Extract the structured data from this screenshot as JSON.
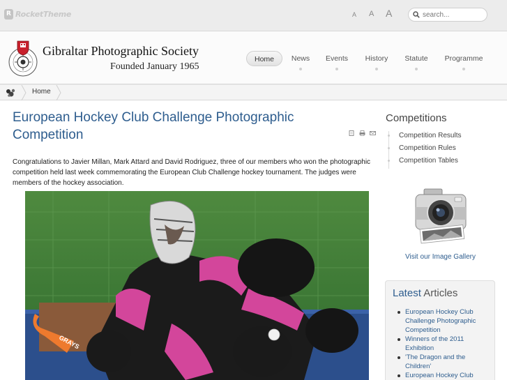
{
  "topbar": {
    "brand": "RocketTheme",
    "font_sizes": [
      "A",
      "A",
      "A"
    ],
    "search_placeholder": "search..."
  },
  "header": {
    "title": "Gibraltar Photographic Society",
    "subtitle": "Founded January 1965",
    "seal_text": "GIBRALTAR PHOTOGRAPHIC SOCIETY"
  },
  "nav": {
    "items": [
      {
        "label": "Home",
        "active": true
      },
      {
        "label": "News"
      },
      {
        "label": "Events"
      },
      {
        "label": "History"
      },
      {
        "label": "Statute"
      },
      {
        "label": "Programme"
      }
    ]
  },
  "breadcrumb": {
    "home": "Home"
  },
  "article": {
    "title": "European Hockey Club Challenge Photographic Competition",
    "body": " Congratulations to Javier Millan, Mark Attard and David Rodriguez, three of our members  who won the photographic competition held last week commemorating the European Club Challenge hockey tournament. The judges were members of the hockey association.",
    "icons": [
      "pdf-icon",
      "print-icon",
      "email-icon"
    ],
    "stick_text": "GRAYS"
  },
  "sidebar": {
    "competitions_title": "Competitions",
    "competitions": [
      "Competition Results",
      "Competition Rules",
      "Competition Tables"
    ],
    "gallery_link": "Visit our Image Gallery",
    "latest_title_highlight": "Latest",
    "latest_title_rest": "Articles",
    "latest": [
      "European Hockey Club Challenge Photographic Competition",
      "Winners of the 2011 Exhibition",
      "'The Dragon and the Children'",
      "European Hockey Club"
    ]
  },
  "colors": {
    "link": "#2e5d8e",
    "pink": "#d3469b",
    "grass": "#3a7d3a"
  }
}
